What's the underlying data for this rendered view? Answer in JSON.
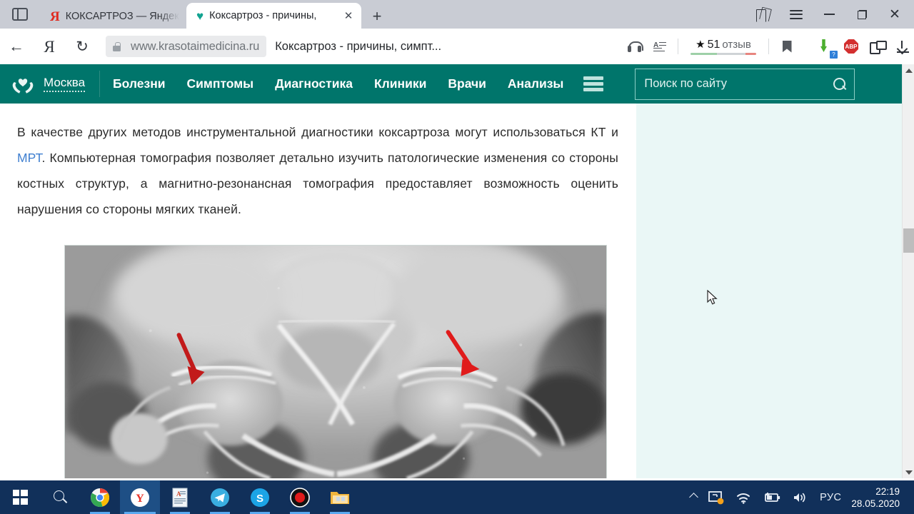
{
  "browser": {
    "sidebar_toggle_icon": "sidebar-panel-icon",
    "tabs": [
      {
        "title": "КОКСАРТРОЗ — Яндекс: на",
        "favicon": "yandex-icon",
        "active": false
      },
      {
        "title": "Коксартроз - причины,",
        "favicon": "heart-icon",
        "active": true
      }
    ],
    "new_tab_label": "+",
    "tab_close_label": "✕",
    "window_controls": {
      "collections": "collections-icon",
      "menu": "hamburger-menu-icon",
      "minimize": "minimize-icon",
      "restore": "restore-icon",
      "close": "close-icon"
    },
    "nav": {
      "back_label": "←",
      "yandex_label": "Я",
      "reload_label": "↻"
    },
    "omnibox": {
      "lock_icon": "lock-icon",
      "domain": "www.krasotaimedicina.ru",
      "page_title": "Коксартроз - причины, симпт...",
      "headphones_icon": "headphones-icon",
      "reader_icon": "reader-mode-icon",
      "rating": {
        "star": "★",
        "count": "51",
        "word": "отзыв"
      },
      "bookmark_icon": "bookmark-icon"
    },
    "extensions": [
      {
        "name": "download-helper-icon",
        "badge": "?"
      },
      {
        "name": "adblock-plus-icon",
        "label": "ABP"
      },
      {
        "name": "translate-icon"
      },
      {
        "name": "downloads-icon"
      }
    ]
  },
  "site": {
    "logo": {
      "icon": "heart-in-hands-logo",
      "city": "Москва"
    },
    "nav_items": [
      {
        "label": "Болезни"
      },
      {
        "label": "Симптомы"
      },
      {
        "label": "Диагностика"
      },
      {
        "label": "Клиники"
      },
      {
        "label": "Врачи"
      },
      {
        "label": "Анализы"
      }
    ],
    "burger_icon": "hamburger-menu-icon",
    "search": {
      "placeholder": "Поиск по сайту",
      "value": "",
      "icon": "search-icon"
    },
    "accent_color": "#00756b",
    "aside_color": "#eaf7f6"
  },
  "article": {
    "paragraph_part1": "В качестве других методов инструментальной диагностики коксартроза могут использоваться КТ и ",
    "link_text": "МРТ",
    "paragraph_part2": ". Компьютерная томография позволяет детально изучить патологические изменения со стороны костных структур, а магнитно-резонансная томография предоставляет возможность оценить нарушения со стороны мягких тканей.",
    "link_color": "#3f7fd0",
    "figure": {
      "name": "hip-xray-image",
      "description": "Рентгенограмма тазобедренных суставов",
      "annotation_color": "#c21a1a",
      "arrows": 2
    }
  },
  "scrollbar": {
    "up_arrow": "scroll-up-arrow",
    "down_arrow": "scroll-down-arrow",
    "thumb_position_pct": 40
  },
  "taskbar": {
    "start_icon": "windows-start-icon",
    "search_icon": "search-icon",
    "apps": [
      {
        "name": "chrome-icon",
        "state": "open"
      },
      {
        "name": "yandex-browser-icon",
        "state": "selected"
      },
      {
        "name": "word-document-icon",
        "state": "open"
      },
      {
        "name": "telegram-icon",
        "state": "open"
      },
      {
        "name": "skype-icon",
        "state": "open"
      },
      {
        "name": "screen-recorder-icon",
        "state": "open"
      },
      {
        "name": "file-explorer-icon",
        "state": "open"
      }
    ],
    "tray": {
      "overflow_icon": "chevron-up-icon",
      "display_icon": "display-settings-icon",
      "wifi_icon": "wifi-icon",
      "battery_icon": "battery-charging-icon",
      "volume_icon": "volume-icon",
      "language": "РУС",
      "time": "22:19",
      "date": "28.05.2020"
    }
  }
}
